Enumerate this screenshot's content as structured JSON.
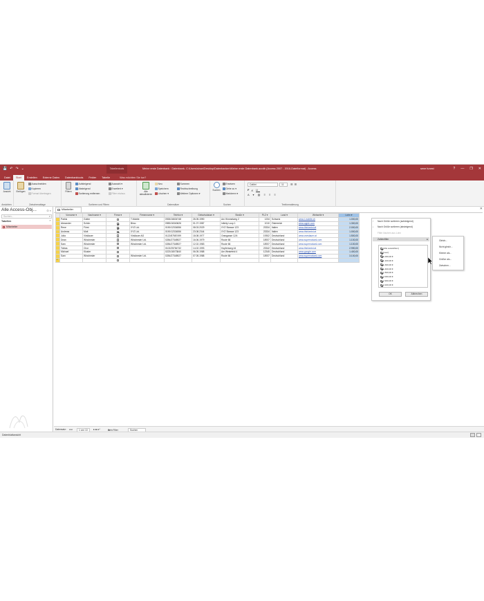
{
  "titlebar": {
    "qat": [
      "💾",
      "↶",
      "↷",
      "⌄"
    ],
    "context_tab": "Tabellentools",
    "doc_title": "Meine erste Datenbank : Datenbank- C:\\Users\\sinan\\Desktop\\Datenbanken\\Meine erste Datenbank.accdb (Access 2007 - 2016-Dateiformat) - Access",
    "user": "sene funest",
    "window_buttons": [
      "?",
      "—",
      "❐",
      "✕"
    ]
  },
  "tabs": [
    "Datei",
    "Start",
    "Erstellen",
    "Externe Daten",
    "Datenbanktools",
    "Felder",
    "Tabelle"
  ],
  "tell_me": "Was möchten Sie tun?",
  "ribbon": {
    "ansicht": "Ansicht",
    "ansichten_group": "Ansichten",
    "einfuegen": "Einfügen",
    "clipboard": [
      "Ausschneiden",
      "Kopieren",
      "Format übertragen"
    ],
    "clipboard_group": "Zwischenablage",
    "filtern": "Filtern",
    "sort": [
      "Aufsteigend",
      "Absteigend",
      "Sortierung entfernen"
    ],
    "filter_small": [
      "Auswahl",
      "Erweitert",
      "Filter ein/aus"
    ],
    "sort_group": "Sortieren und Filtern",
    "alle_aktualisieren": "Alle aktualisieren",
    "records": [
      "Neu",
      "Speichern",
      "Löschen"
    ],
    "records2": [
      "Summen",
      "Rechtschreibung",
      "Weitere Optionen"
    ],
    "records_group": "Datensätze",
    "suchen": "Suchen",
    "find": [
      "Ersetzen",
      "Gehe zu",
      "Markieren"
    ],
    "find_group": "Suchen",
    "font_name": "Calibri",
    "font_size": "11",
    "text_group": "Textformatierung"
  },
  "nav": {
    "header": "Alle Access-Obj...",
    "search_placeholder": "Suchen...",
    "section": "Tabellen",
    "item": "Mitarbeiter"
  },
  "doc_tab": "Mitarbeiter",
  "table": {
    "columns": [
      "Vorname",
      "Nachname",
      "Firma",
      "Firmenname",
      "Telefon",
      "Geburtsdatum",
      "Straße",
      "PLZ",
      "Land",
      "Webseite",
      "Lohn"
    ],
    "rows": [
      [
        "Parkis",
        "Gotter",
        false,
        "T-Mobile",
        "0926/16634748",
        "26.05.1990",
        "Am Himmelweg 2",
        "1234",
        "Schweiz",
        "www.t-mobile.ch",
        "1.000,00"
      ],
      [
        "Alexander",
        "Schön",
        true,
        "Bimo",
        "0983/16340626",
        "01.07.1987",
        "Infinity Loop 1",
        "1010",
        "Österreich",
        "www.apple.com",
        "1.300,00"
      ],
      [
        "Rene",
        "Fürst",
        true,
        "XYZ Ltd.",
        "0190/12334556",
        "08.03.2029",
        "XYZ Strasse 123",
        "23334",
        "Italien",
        "www.thinkexist.at",
        "2.000,00"
      ],
      [
        "Andreas",
        "Mott",
        true,
        "XYZ Ltd.",
        "0190/12334556",
        "23.08.2344",
        "XYZ Strasse 123",
        "23334",
        "Italien",
        "www.thinkexist.at",
        "1.000,00"
      ],
      [
        "Julia",
        "Vösllauer",
        false,
        "Vösllauer AG",
        "0122/87587499",
        "18.08.1977",
        "Orangasse 12/4",
        "19302",
        "Deutschland",
        "www.voeslauer.at",
        "1.500,00"
      ],
      [
        "Dean",
        "Winchester",
        false,
        "Winchester Ltd.",
        "0284/27348927",
        "16.06.1979",
        "Route 66",
        "18937",
        "Deutschland",
        "www.supernatural.com",
        "1.100,00"
      ],
      [
        "Sam",
        "Winchester",
        false,
        "Winchester Ltd.",
        "0284/27348927",
        "12.02.1983",
        "Route 66",
        "18937",
        "Deutschland",
        "www.supernatural.com",
        "1.100,00"
      ],
      [
        "Tobias",
        "Chor",
        false,
        "",
        "0102/25784732",
        "14.02.1993",
        "Hopfenweg 44",
        "23342",
        "Deutschland",
        "www.thinkexist.at",
        "2.990,00"
      ],
      [
        "Michael",
        "Kloster",
        false,
        "",
        "0223/18073840",
        "06.05.1988",
        "Am Westefeld 4",
        "12345",
        "Deutschland",
        "www.google.com",
        "1.400,00"
      ],
      [
        "Sam",
        "Winchester",
        false,
        "Winchester Ltd.",
        "0284/27348927",
        "07.05.1988",
        "Route 66",
        "18937",
        "Deutschland",
        "www.supernatural.com",
        "3.100,00"
      ]
    ]
  },
  "filter_menu": {
    "sort_asc": "Nach Größe sortieren (aufsteigend)",
    "sort_desc": "Nach Größe sortieren (absteigend)",
    "clear": "Filter löschen aus Lohn",
    "zahlenfilter": "Zahlenfilter",
    "items": [
      "(Alle auswählen)",
      "(Leer)",
      "1.000,00 €",
      "1.100,00 €",
      "1.300,00 €",
      "1.400,00 €",
      "1.500,00 €",
      "2.000,00 €",
      "2.990,00 €",
      "3.100,00 €"
    ],
    "ok": "OK",
    "cancel": "Abbrechen"
  },
  "submenu": [
    "Gleich...",
    "Nicht gleich...",
    "Kleiner als...",
    "Größer als...",
    "Zwischen..."
  ],
  "record_bar": {
    "label": "Datensatz:",
    "position": "1 von 10",
    "nav": "◂ ◂ ▸ ▸▸",
    "filter": "Kein Filter",
    "search": "Suchen"
  },
  "status": "Datenblattansicht",
  "colors": {
    "accent": "#a4373a",
    "selected_row": "#f5d24a",
    "highlight_col": "#c5dcf2",
    "link": "#2b53b3"
  }
}
